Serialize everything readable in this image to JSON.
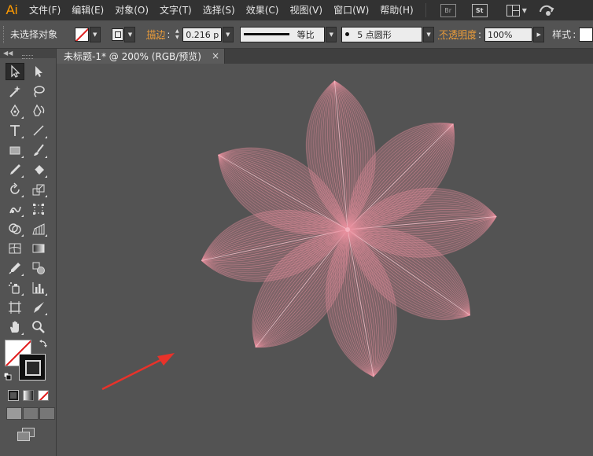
{
  "app": {
    "logo": "Ai"
  },
  "menu": [
    "文件(F)",
    "编辑(E)",
    "对象(O)",
    "文字(T)",
    "选择(S)",
    "效果(C)",
    "视图(V)",
    "窗口(W)",
    "帮助(H)"
  ],
  "app_buttons": {
    "bridge": "Br",
    "stock": "St"
  },
  "control_bar": {
    "selection_status": "未选择对象",
    "stroke_label": "描边",
    "stroke_weight": "0.216 p",
    "stroke_profile": "等比",
    "brush": "5 点圆形",
    "opacity_label": "不透明度",
    "opacity_value": "100%",
    "style_label": "样式"
  },
  "document": {
    "tab_title": "未标题-1* @ 200% (RGB/预览)",
    "close_symbol": "×"
  },
  "colors": {
    "accent_orange": "#ff9a00",
    "petal_pink": "#e8909e",
    "arrow_red": "#e8322a",
    "canvas_gray": "#535353"
  },
  "tools": [
    [
      "selection-tool-icon",
      "direct-selection-tool-icon"
    ],
    [
      "magic-wand-tool-icon",
      "lasso-tool-icon"
    ],
    [
      "pen-tool-icon",
      "curvature-tool-icon"
    ],
    [
      "type-tool-icon",
      "line-segment-tool-icon"
    ],
    [
      "rectangle-tool-icon",
      "paintbrush-tool-icon"
    ],
    [
      "pencil-tool-icon",
      "eraser-tool-icon"
    ],
    [
      "rotate-tool-icon",
      "scale-tool-icon"
    ],
    [
      "warp-tool-icon",
      "free-transform-tool-icon"
    ],
    [
      "shape-builder-tool-icon",
      "perspective-grid-tool-icon"
    ],
    [
      "mesh-tool-icon",
      "gradient-tool-icon"
    ],
    [
      "eyedropper-tool-icon",
      "blend-tool-icon"
    ],
    [
      "symbol-sprayer-tool-icon",
      "column-graph-tool-icon"
    ],
    [
      "artboard-tool-icon",
      "slice-tool-icon"
    ],
    [
      "hand-tool-icon",
      "zoom-tool-icon"
    ]
  ]
}
